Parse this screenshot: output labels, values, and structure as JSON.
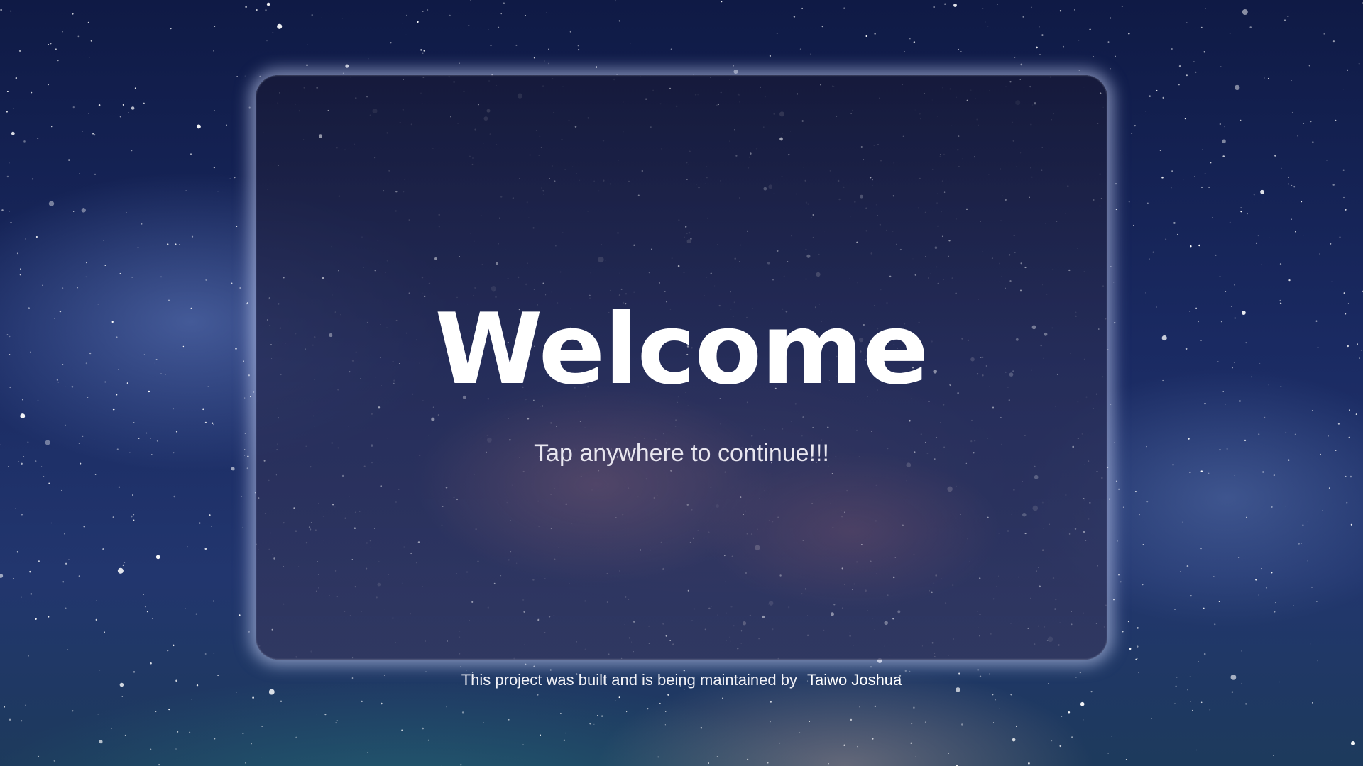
{
  "welcome": {
    "title": "Welcome",
    "subtitle": "Tap anywhere to continue!!!"
  },
  "footer": {
    "text": "This project was built and is being maintained by",
    "author": "Taiwo Joshua"
  },
  "colors": {
    "sky_top": "#0f1a45",
    "sky_bottom": "#1d3a5c",
    "card_glow": "#d2dcff",
    "text": "#ffffff"
  },
  "background": {
    "image": "starry-night-sky"
  }
}
